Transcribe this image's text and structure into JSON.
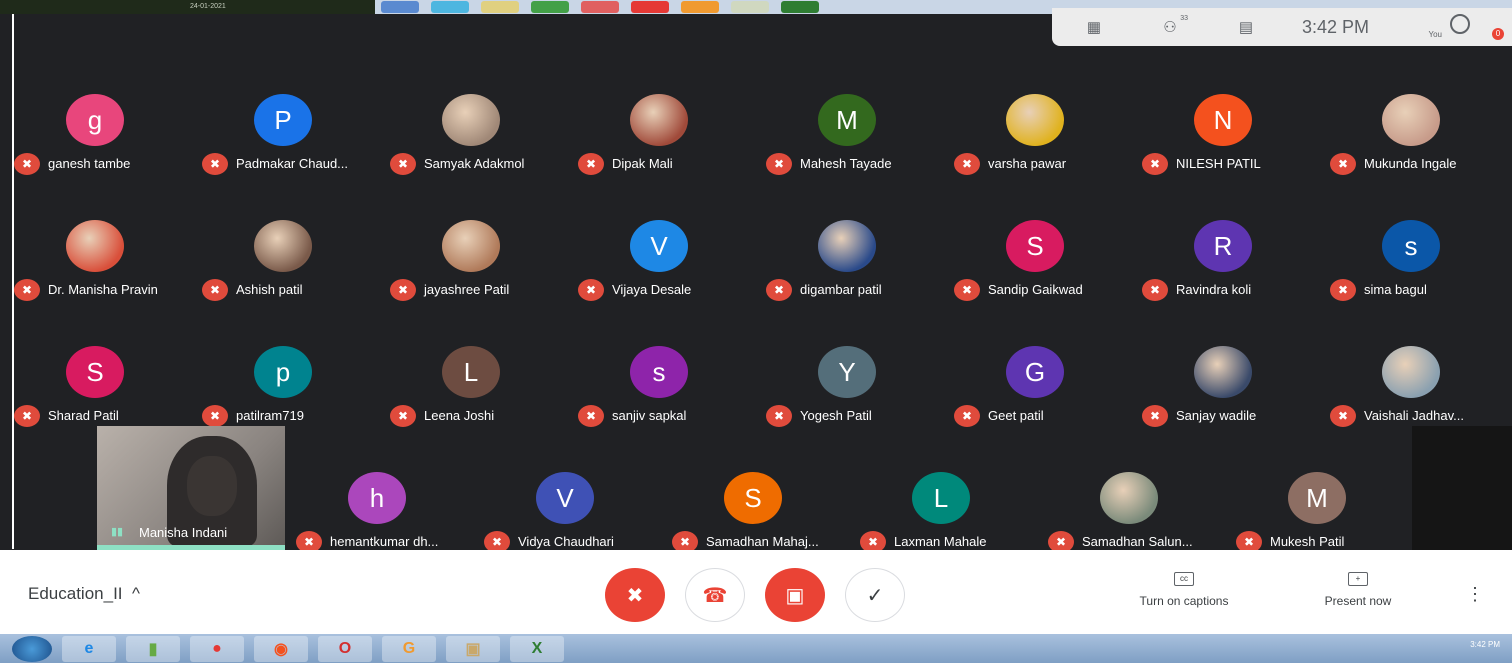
{
  "top_taskbar": {
    "left_text": "24-01-2021"
  },
  "header": {
    "participant_count": "33",
    "time": "3:42 PM",
    "you_label": "You",
    "notification_badge": "0"
  },
  "participants_row1": [
    {
      "initial": "g",
      "name": "ganesh tambe",
      "color": "#e8467c",
      "photo": false
    },
    {
      "initial": "P",
      "name": "Padmakar Chaud...",
      "color": "#1a73e8",
      "photo": false
    },
    {
      "initial": "",
      "name": "Samyak Adakmol",
      "color": "#a08877",
      "photo": true
    },
    {
      "initial": "",
      "name": "Dipak Mali",
      "color": "#a04a3a",
      "photo": true
    },
    {
      "initial": "M",
      "name": "Mahesh Tayade",
      "color": "#33691e",
      "photo": false
    },
    {
      "initial": "",
      "name": "varsha pawar",
      "color": "#e0b21e",
      "photo": true
    },
    {
      "initial": "N",
      "name": "NILESH PATIL",
      "color": "#f4511e",
      "photo": false
    },
    {
      "initial": "",
      "name": "Mukunda Ingale",
      "color": "#c79b8a",
      "photo": true
    }
  ],
  "participants_row2": [
    {
      "initial": "",
      "name": "Dr. Manisha Pravin",
      "color": "#d94f3a",
      "photo": true
    },
    {
      "initial": "",
      "name": "Ashish patil",
      "color": "#7a5a4a",
      "photo": true
    },
    {
      "initial": "",
      "name": "jayashree Patil",
      "color": "#b07a5a",
      "photo": true
    },
    {
      "initial": "V",
      "name": "Vijaya Desale",
      "color": "#1e88e5",
      "photo": false
    },
    {
      "initial": "",
      "name": "digambar patil",
      "color": "#2a4a8a",
      "photo": true
    },
    {
      "initial": "S",
      "name": "Sandip Gaikwad",
      "color": "#d81b60",
      "photo": false
    },
    {
      "initial": "R",
      "name": "Ravindra koli",
      "color": "#5e35b1",
      "photo": false
    },
    {
      "initial": "s",
      "name": "sima bagul",
      "color": "#0b57a8",
      "photo": false
    }
  ],
  "participants_row3": [
    {
      "initial": "S",
      "name": "Sharad Patil",
      "color": "#d81b60",
      "photo": false
    },
    {
      "initial": "p",
      "name": "patilram719",
      "color": "#00838f",
      "photo": false
    },
    {
      "initial": "L",
      "name": "Leena Joshi",
      "color": "#6d4c41",
      "photo": false
    },
    {
      "initial": "s",
      "name": "sanjiv sapkal",
      "color": "#8e24aa",
      "photo": false
    },
    {
      "initial": "Y",
      "name": "Yogesh Patil",
      "color": "#546e7a",
      "photo": false
    },
    {
      "initial": "G",
      "name": "Geet patil",
      "color": "#5e35b1",
      "photo": false
    },
    {
      "initial": "",
      "name": "Sanjay wadile",
      "color": "#3a4a6a",
      "photo": true
    },
    {
      "initial": "",
      "name": "Vaishali Jadhav...",
      "color": "#8aa0b0",
      "photo": true
    }
  ],
  "participants_row4": [
    {
      "initial": "h",
      "name": "hemantkumar dh...",
      "color": "#ab47bc",
      "photo": false
    },
    {
      "initial": "V",
      "name": "Vidya Chaudhari",
      "color": "#3f51b5",
      "photo": false
    },
    {
      "initial": "S",
      "name": "Samadhan Mahaj...",
      "color": "#ef6c00",
      "photo": false
    },
    {
      "initial": "L",
      "name": "Laxman Mahale",
      "color": "#00897b",
      "photo": false
    },
    {
      "initial": "",
      "name": "Samadhan Salun...",
      "color": "#7a8a7a",
      "photo": true
    },
    {
      "initial": "M",
      "name": "Mukesh Patil",
      "color": "#8d6e63",
      "photo": false
    }
  ],
  "self_tile": {
    "name": "Manisha Indani"
  },
  "controls": {
    "meeting_name": "Education_II",
    "expand_icon": "^",
    "captions_label": "Turn on captions",
    "present_label": "Present now",
    "more_icon": "⋮"
  },
  "taskbar": {
    "tray_time": "3:42 PM"
  }
}
